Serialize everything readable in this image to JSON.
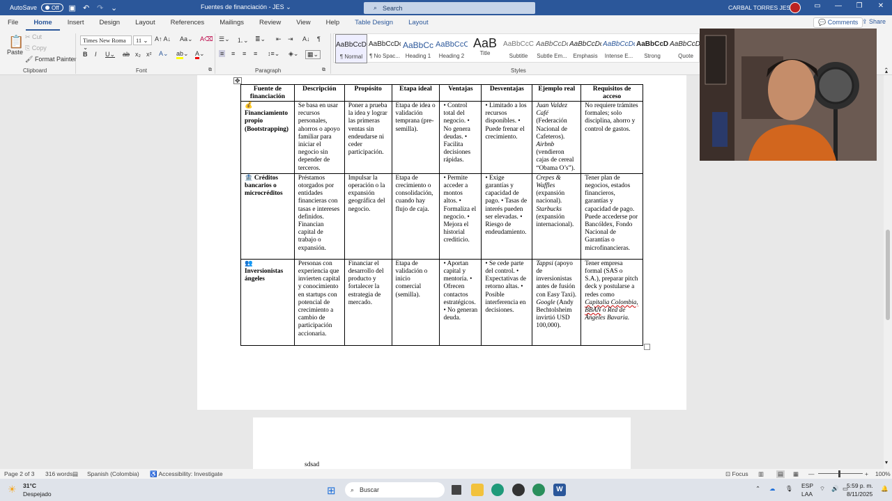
{
  "titlebar": {
    "autosave_label": "AutoSave",
    "autosave_state": "Off",
    "doc_title": "Fuentes de financiación - JES",
    "search_label": "Search",
    "user_name": "CARBAL TORRES JESUS"
  },
  "menu": {
    "tabs": [
      "File",
      "Home",
      "Insert",
      "Design",
      "Layout",
      "References",
      "Mailings",
      "Review",
      "View",
      "Help",
      "Table Design",
      "Layout"
    ],
    "active_tab": "Home",
    "comments_label": "Comments",
    "share_label": "Share"
  },
  "ribbon": {
    "clipboard": {
      "paste": "Paste",
      "cut": "Cut",
      "copy": "Copy",
      "format_painter": "Format Painter",
      "group_label": "Clipboard"
    },
    "font": {
      "font_name": "Times New Roma",
      "font_size": "11",
      "group_label": "Font"
    },
    "paragraph": {
      "group_label": "Paragraph"
    },
    "styles": {
      "group_label": "Styles",
      "items": [
        {
          "preview": "AaBbCcDc",
          "name": "¶ Normal"
        },
        {
          "preview": "AaBbCcDc",
          "name": "¶ No Spac..."
        },
        {
          "preview": "AaBbCc",
          "name": "Heading 1"
        },
        {
          "preview": "AaBbCcC",
          "name": "Heading 2"
        },
        {
          "preview": "AaB",
          "name": "Title"
        },
        {
          "preview": "AaBbCcC",
          "name": "Subtitle"
        },
        {
          "preview": "AaBbCcDc",
          "name": "Subtle Em..."
        },
        {
          "preview": "AaBbCcDc",
          "name": "Emphasis"
        },
        {
          "preview": "AaBbCcDc",
          "name": "Intense E..."
        },
        {
          "preview": "AaBbCcDc",
          "name": "Strong"
        },
        {
          "preview": "AaBbCcDc",
          "name": "Quote"
        }
      ]
    }
  },
  "table": {
    "headers": [
      "Fuente de financiación",
      "Descripción",
      "Propósito",
      "Etapa ideal",
      "Ventajas",
      "Desventajas",
      "Ejemplo real",
      "Requisitos de acceso"
    ],
    "rows": [
      {
        "source": "💰 Financiamiento propio (Bootstrapping)",
        "description": "Se basa en usar recursos personales, ahorros o apoyo familiar para iniciar el negocio sin depender de terceros.",
        "purpose": "Poner a prueba la idea y lograr las primeras ventas sin endeudarse ni ceder participación.",
        "stage": "Etapa de idea o validación temprana (pre-semilla).",
        "advantages": "• Control total del negocio. • No genera deudas. • Facilita decisiones rápidas.",
        "disadvantages": "• Limitado a los recursos disponibles. • Puede frenar el crecimiento.",
        "example_a": "Juan Valdez Café",
        "example_b": " (Federación Nacional de Cafeteros). ",
        "example_c": "Airbnb",
        "example_d": " (vendieron cajas de cereal “Obama O’s”).",
        "requirements": "No requiere trámites formales; solo disciplina, ahorro y control de gastos."
      },
      {
        "source": "🏦 Créditos bancarios o microcréditos",
        "description": "Préstamos otorgados por entidades financieras con tasas e intereses definidos. Financian capital de trabajo o expansión.",
        "purpose": "Impulsar la operación o la expansión geográfica del negocio.",
        "stage": "Etapa de crecimiento o consolidación, cuando hay flujo de caja.",
        "advantages": "• Permite acceder a montos altos. • Formaliza el negocio. • Mejora el historial crediticio.",
        "disadvantages": "• Exige garantías y capacidad de pago. • Tasas de interés pueden ser elevadas. • Riesgo de endeudamiento.",
        "example_a": "Crepes & Waffles",
        "example_b": " (expansión nacional). ",
        "example_c": "Starbucks",
        "example_d": " (expansión internacional).",
        "requirements": "Tener plan de negocios, estados financieros, garantías y capacidad de pago. Puede accederse por Bancóldex, Fondo Nacional de Garantías o microfinancieras."
      },
      {
        "source": "👥 Inversionistas ángeles",
        "description": "Personas con experiencia que invierten capital y conocimiento en startups con potencial de crecimiento a cambio de participación accionaria.",
        "purpose": "Financiar el desarrollo del producto y fortalecer la estrategia de mercado.",
        "stage": "Etapa de validación o inicio comercial (semilla).",
        "advantages": "• Aportan capital y mentoría. • Ofrecen contactos estratégicos. • No generan deuda.",
        "disadvantages": "• Se cede parte del control. • Expectativas de retorno altas. • Posible interferencia en decisiones.",
        "example_a": "Tappsi",
        "example_b": " (apoyo de inversionistas antes de fusión con Easy Taxi). ",
        "example_c": "Google",
        "example_d": " (Andy Bechtolsheim invirtió USD 100,000).",
        "requirements_a": "Tener empresa formal (SAS o S.A.), preparar pitch deck y postularse a redes como ",
        "requirements_b": "Capitalia Colombia, BBAN",
        "requirements_c": " o ",
        "requirements_d": "Red de Ángeles Bavaria."
      }
    ]
  },
  "next_page_text": "sdsad",
  "statusbar": {
    "page": "Page 2 of 3",
    "words": "316 words",
    "language": "Spanish (Colombia)",
    "accessibility": "Accessibility: Investigate",
    "focus": "Focus",
    "zoom": "100%"
  },
  "taskbar": {
    "weather_temp": "31°C",
    "weather_desc": "Despejado",
    "search_placeholder": "Buscar",
    "lang_1": "ESP",
    "lang_2": "LAA",
    "time": "5:59 p. m.",
    "date": "8/11/2025"
  },
  "colors": {
    "accent": "#2b579a",
    "ribbon_bg": "#f3f3f3",
    "canvas_bg": "#e8e8e8"
  }
}
